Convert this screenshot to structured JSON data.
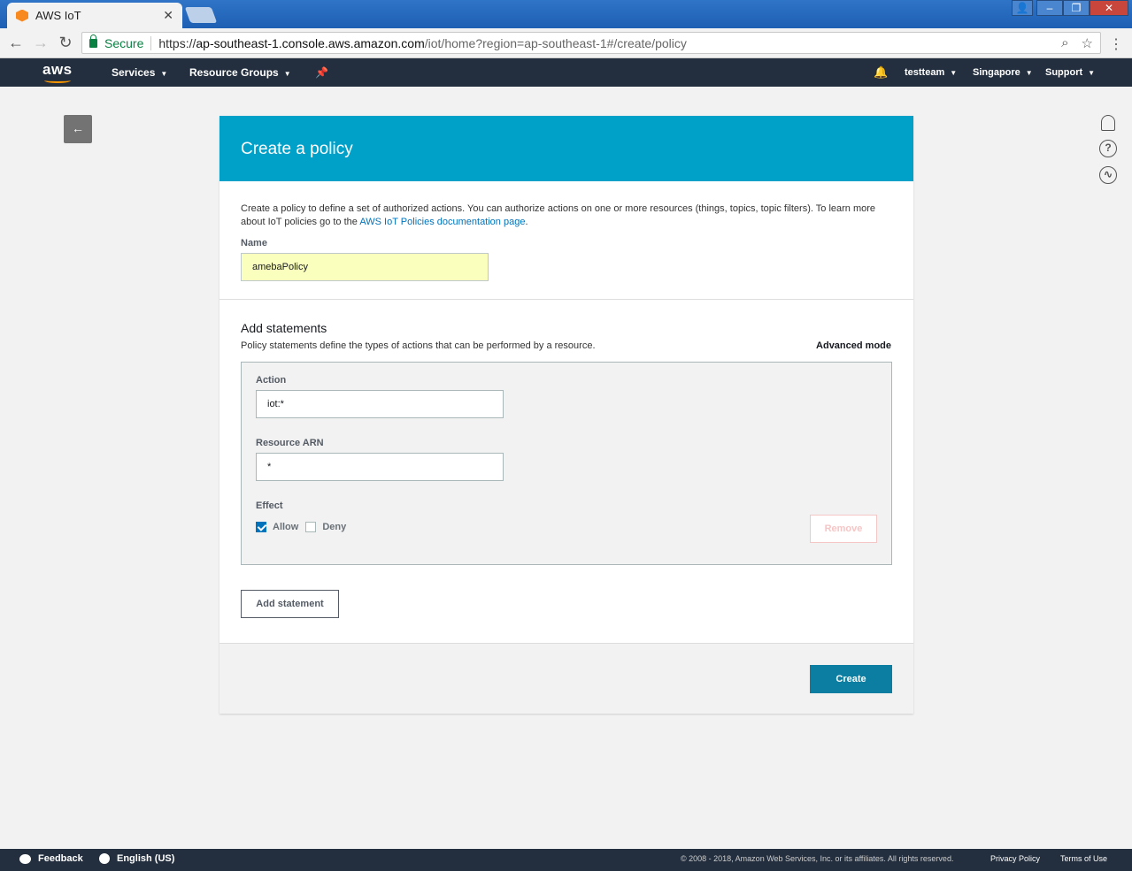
{
  "browser": {
    "tab_title": "AWS IoT",
    "tab_close": "✕",
    "secure_label": "Secure",
    "url_scheme": "https://",
    "url_host": "ap-southeast-1.console.aws.amazon.com",
    "url_path": "/iot/home?region=ap-southeast-1#/create/policy"
  },
  "awsnav": {
    "logo": "aws",
    "services": "Services",
    "resource_groups": "Resource Groups",
    "account": "testteam",
    "region": "Singapore",
    "support": "Support"
  },
  "page": {
    "title": "Create a policy",
    "description": "Create a policy to define a set of authorized actions. You can authorize actions on one or more resources (things, topics, topic filters). To learn more about IoT policies go to the ",
    "doc_link": "AWS IoT Policies documentation page",
    "description_end": ".",
    "name_label": "Name",
    "name_value": "amebaPolicy"
  },
  "statements": {
    "heading": "Add statements",
    "subtext": "Policy statements define the types of actions that can be performed by a resource.",
    "advanced_mode": "Advanced mode",
    "action_label": "Action",
    "action_value": "iot:*",
    "resource_label": "Resource ARN",
    "resource_value": "*",
    "effect_label": "Effect",
    "allow_label": "Allow",
    "deny_label": "Deny",
    "remove_label": "Remove",
    "add_statement_label": "Add statement"
  },
  "actions": {
    "create_label": "Create"
  },
  "footer": {
    "feedback": "Feedback",
    "language": "English (US)",
    "copyright": "© 2008 - 2018, Amazon Web Services, Inc. or its affiliates. All rights reserved.",
    "privacy": "Privacy Policy",
    "terms": "Terms of Use"
  },
  "colors": {
    "header_blue": "#00a1c9",
    "nav_dark": "#232f3e",
    "primary_button": "#0b7ea1"
  }
}
